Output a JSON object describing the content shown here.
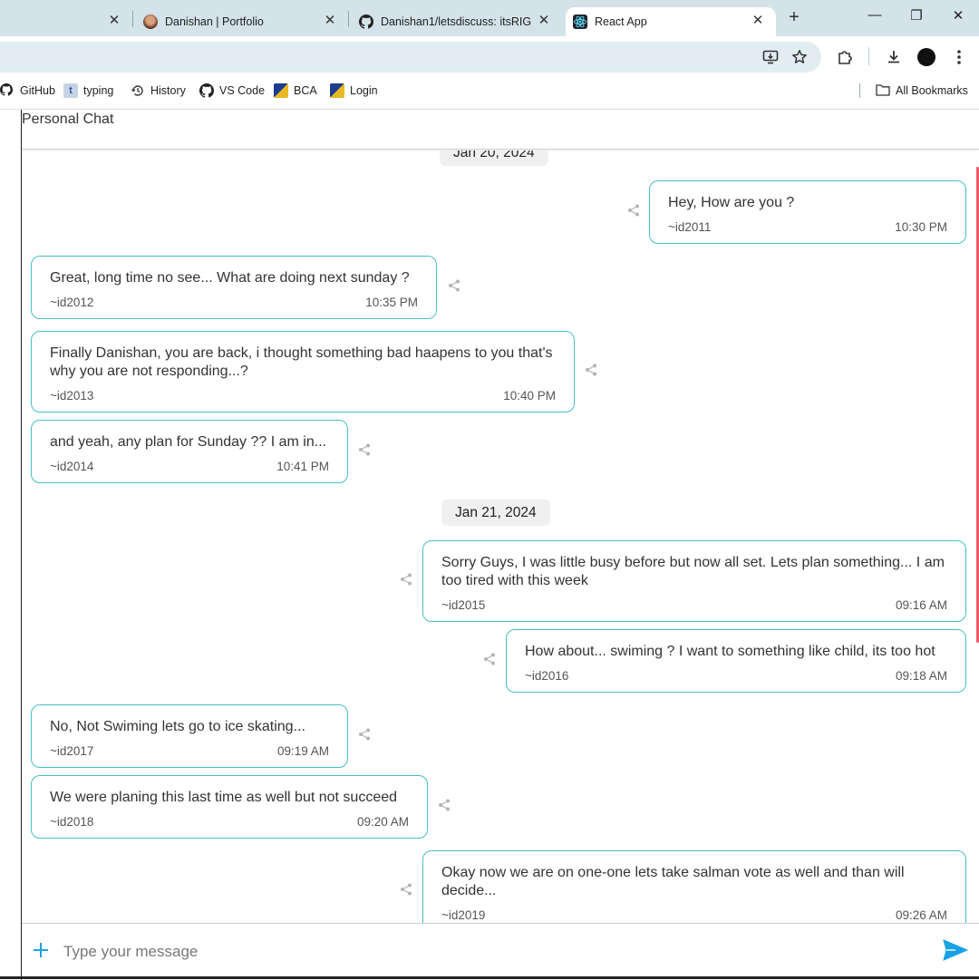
{
  "browser": {
    "tabs": [
      {
        "title": "",
        "active": false
      },
      {
        "title": "Danishan | Portfolio",
        "active": false
      },
      {
        "title": "Danishan1/letsdiscuss: itsRIGHT",
        "active": false
      },
      {
        "title": "React App",
        "active": true
      }
    ],
    "new_tab_icon": "+",
    "window_controls": {
      "minimize": "—",
      "restore": "❐",
      "close": "✕"
    },
    "toolbar_icons": [
      "install-app-icon",
      "star-icon",
      "extensions-icon",
      "download-icon",
      "profile-avatar",
      "menu-icon"
    ],
    "bookmarks": [
      {
        "label": "GitHub",
        "icon": "github-icon"
      },
      {
        "label": "typing",
        "icon": "typing-icon"
      },
      {
        "label": "History",
        "icon": "history-icon"
      },
      {
        "label": "VS Code",
        "icon": "github-icon"
      },
      {
        "label": "BCA",
        "icon": "bca-icon"
      },
      {
        "label": "Login",
        "icon": "bca-icon"
      }
    ],
    "all_bookmarks": "All Bookmarks"
  },
  "chat": {
    "title": "Personal Chat",
    "dates": [
      "Jan 20, 2024",
      "Jan 21, 2024"
    ],
    "messages": [
      {
        "text": "Hey, How are you ?",
        "user": "~id2011",
        "time": "10:30 PM",
        "side": "right"
      },
      {
        "text": "Great, long time no see... What are doing next sunday ?",
        "user": "~id2012",
        "time": "10:35 PM",
        "side": "left"
      },
      {
        "text": "Finally Danishan, you are back, i thought something bad haapens to you that's why you are not responding...?",
        "user": "~id2013",
        "time": "10:40 PM",
        "side": "left"
      },
      {
        "text": "and yeah, any plan for Sunday ?? I am in...",
        "user": "~id2014",
        "time": "10:41 PM",
        "side": "left"
      },
      {
        "text": "Sorry Guys, I was little busy before but now all set. Lets plan something... I am too tired with this week",
        "user": "~id2015",
        "time": "09:16 AM",
        "side": "right"
      },
      {
        "text": "How about... swiming ? I want to something like child, its too hot",
        "user": "~id2016",
        "time": "09:18 AM",
        "side": "right"
      },
      {
        "text": "No, Not Swiming lets go to ice skating...",
        "user": "~id2017",
        "time": "09:19 AM",
        "side": "left"
      },
      {
        "text": "We were planing this last time as well but not succeed",
        "user": "~id2018",
        "time": "09:20 AM",
        "side": "left"
      },
      {
        "text": "Okay now we are on one-one lets take salman vote as well and than will decide...",
        "user": "~id2019",
        "time": "09:26 AM",
        "side": "right"
      }
    ],
    "share_icon": "share-icon",
    "composer": {
      "placeholder": "Type your message",
      "value": "",
      "add_icon": "plus-icon",
      "send_icon": "send-icon"
    },
    "accent_color": "#47c0c4",
    "send_color": "#17a2e6"
  }
}
